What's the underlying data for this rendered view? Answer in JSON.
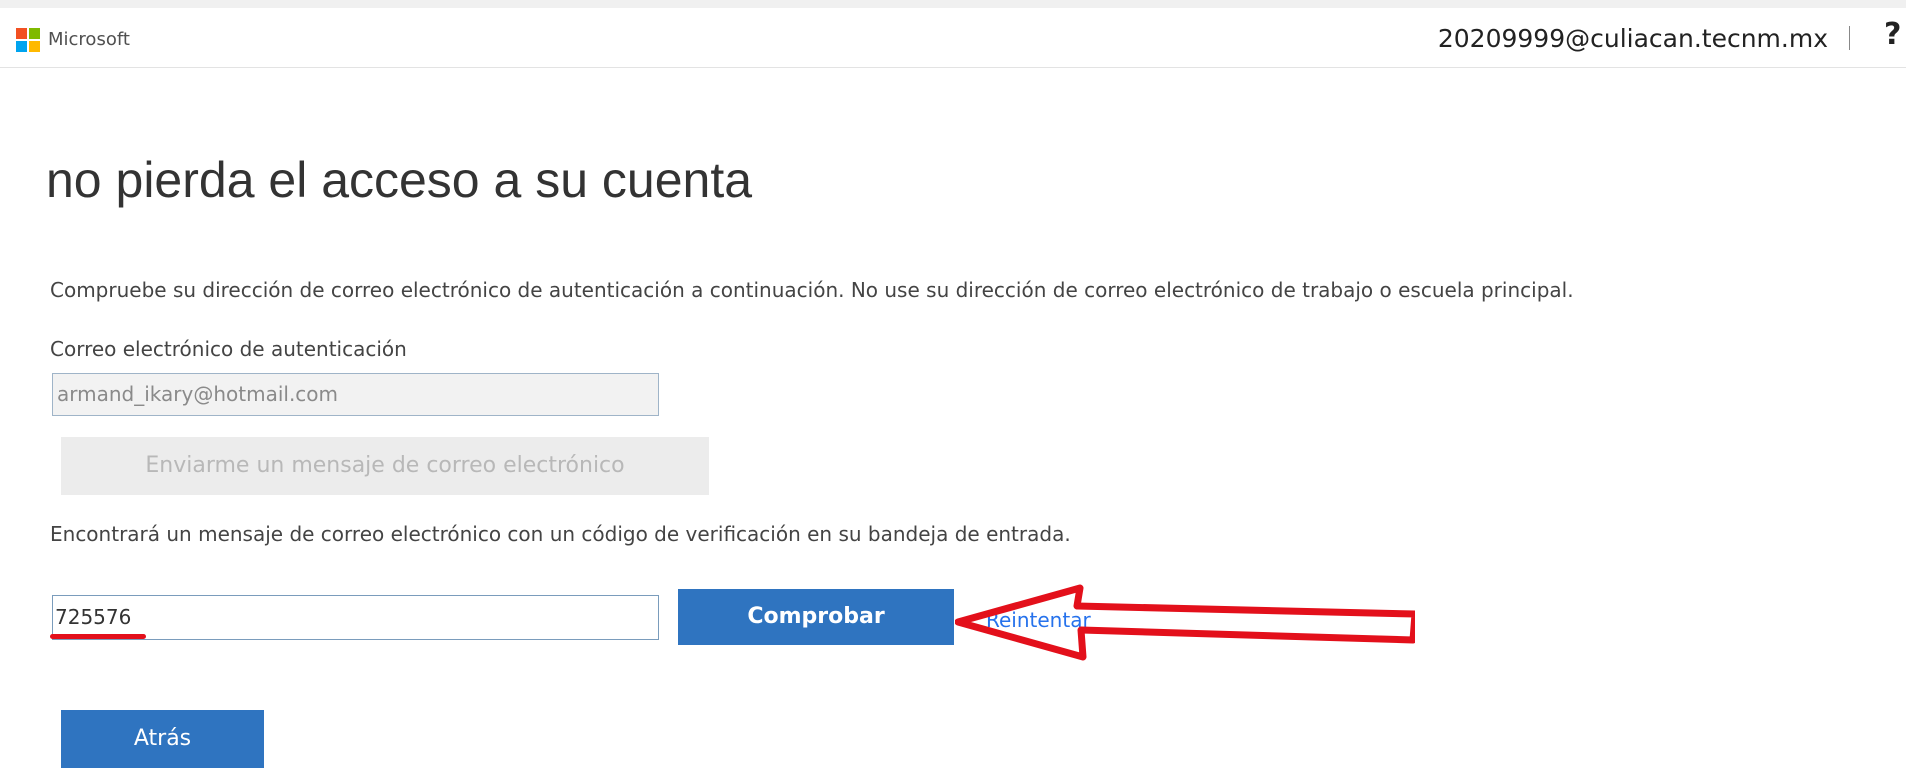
{
  "header": {
    "brand": "Microsoft",
    "user_email": "20209999@culiacan.tecnm.mx",
    "help_symbol": "?"
  },
  "main": {
    "title": "no pierda el acceso a su cuenta",
    "description": "Compruebe su dirección de correo electrónico de autenticación a continuación. No use su dirección de correo electrónico de trabajo o escuela principal.",
    "email_label": "Correo electrónico de autenticación",
    "email_value": "armand_ikary@hotmail.com",
    "send_button": "Enviarme un mensaje de correo electrónico",
    "info_text": "Encontrará un mensaje de correo electrónico con un código de verificación en su bandeja de entrada.",
    "code_value": "725576",
    "verify_button": "Comprobar",
    "retry_link": "Reintentar",
    "back_button": "Atrás"
  },
  "colors": {
    "accent": "#2f74c0",
    "annotation": "#e3101b",
    "link": "#2672ec"
  }
}
